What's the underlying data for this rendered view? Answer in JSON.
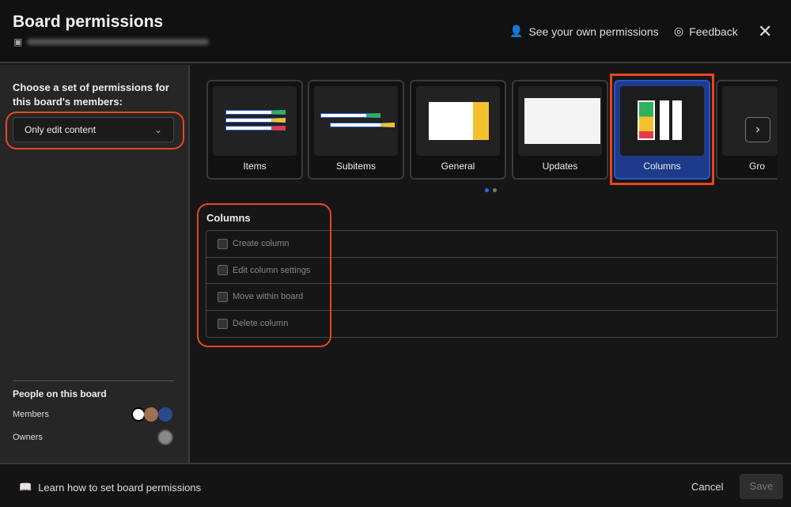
{
  "header": {
    "title": "Board permissions",
    "see_permissions": "See your own permissions",
    "feedback": "Feedback"
  },
  "left": {
    "choose_label": "Choose a set of permissions for this board's members:",
    "selected_permission": "Only edit content",
    "people_title": "People on this board",
    "members_label": "Members",
    "owners_label": "Owners"
  },
  "cards": [
    {
      "label": "Items"
    },
    {
      "label": "Subitems"
    },
    {
      "label": "General"
    },
    {
      "label": "Updates"
    },
    {
      "label": "Columns"
    },
    {
      "label": "Gro"
    }
  ],
  "selected_card": "Columns",
  "carousel": {
    "pages": 2,
    "current": 1
  },
  "columns": {
    "title": "Columns",
    "options": [
      {
        "label": "Create column",
        "checked": false
      },
      {
        "label": "Edit column settings",
        "checked": false
      },
      {
        "label": "Move within board",
        "checked": false
      },
      {
        "label": "Delete column",
        "checked": false
      }
    ]
  },
  "footer": {
    "learn": "Learn how to set board permissions",
    "cancel": "Cancel",
    "save": "Save"
  },
  "colors": {
    "accent": "#2a56c6",
    "highlight": "#e8461f"
  }
}
